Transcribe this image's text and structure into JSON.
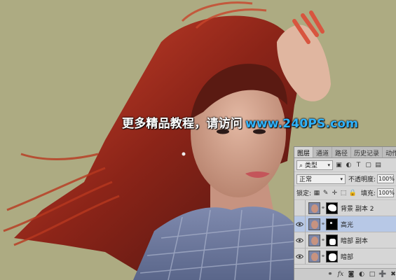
{
  "watermark": {
    "text_cn": "更多精品教程，请访问",
    "url": "www.240PS.com"
  },
  "layers_panel": {
    "tabs": [
      "图层",
      "通道",
      "路径",
      "历史记录",
      "动作"
    ],
    "filter_label": "类型",
    "blend_mode": "正常",
    "opacity_label": "不透明度:",
    "opacity_value": "100%",
    "lock_label": "锁定:",
    "fill_label": "填充:",
    "fill_value": "100%",
    "layers": [
      {
        "name": "背景 副本 2",
        "visible": false,
        "selected": false
      },
      {
        "name": "高光",
        "visible": true,
        "selected": true
      },
      {
        "name": "暗部 副本",
        "visible": true,
        "selected": false
      },
      {
        "name": "暗部",
        "visible": true,
        "selected": false
      }
    ],
    "bottom_icons": [
      "link-icon",
      "fx-icon",
      "mask-icon",
      "adjustment-icon",
      "folder-icon",
      "new-layer-icon",
      "trash-icon"
    ]
  },
  "colors": {
    "canvas_bg": "#adab82",
    "selected_layer": "#b7c8e6",
    "watermark_url": "#2fb3ff"
  }
}
